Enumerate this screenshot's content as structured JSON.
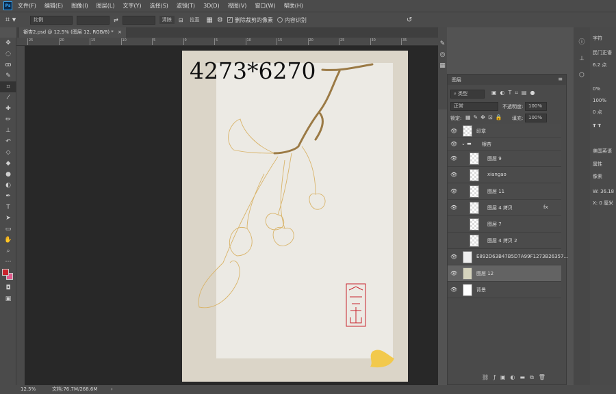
{
  "app": {
    "logo": "Ps"
  },
  "menu": [
    "文件(F)",
    "编辑(E)",
    "图像(I)",
    "图层(L)",
    "文字(Y)",
    "选择(S)",
    "滤镜(T)",
    "3D(D)",
    "视图(V)",
    "窗口(W)",
    "帮助(H)"
  ],
  "options": {
    "ratio": "比例",
    "clear": "清除",
    "straighten": "拉直",
    "delete_cropped": "删除裁剪的像素",
    "delete_cropped_checked": true,
    "content_aware": "内容识别",
    "content_aware_checked": false
  },
  "tab": {
    "title": "银杏2.psd @ 12.5% (图层 12, RGB/8) *",
    "close": "×"
  },
  "ruler": [
    "25",
    "20",
    "15",
    "10",
    "5",
    "0",
    "5",
    "10",
    "15",
    "20",
    "25",
    "30",
    "35"
  ],
  "canvas": {
    "dimension_text": "4273*6270",
    "seal_text": "银杏"
  },
  "layers_panel": {
    "title": "图层",
    "filter": "类型",
    "blend": "正常",
    "opacity_label": "不透明度:",
    "opacity": "100%",
    "lock_label": "锁定:",
    "fill_label": "填充:",
    "fill": "100%",
    "layers": [
      {
        "name": "印章",
        "visible": true,
        "indent": 0
      },
      {
        "name": "银杏",
        "visible": true,
        "group": true,
        "indent": 0
      },
      {
        "name": "图层 9",
        "visible": true,
        "indent": 1
      },
      {
        "name": "xiangao",
        "visible": true,
        "indent": 1
      },
      {
        "name": "图层 11",
        "visible": true,
        "indent": 1
      },
      {
        "name": "图层 4 拷贝",
        "visible": true,
        "indent": 1,
        "fx": "fx"
      },
      {
        "name": "图层 7",
        "visible": false,
        "indent": 1
      },
      {
        "name": "图层 4 拷贝 2",
        "visible": false,
        "indent": 1
      },
      {
        "name": "E892D63B47B5D7A99F1273B26357...",
        "visible": true,
        "indent": 0
      },
      {
        "name": "图层 12",
        "visible": true,
        "indent": 0,
        "selected": true
      },
      {
        "name": "背景",
        "visible": true,
        "indent": 0
      }
    ]
  },
  "character_panel": {
    "tab": "字符",
    "font": "民门正谱",
    "size": "6.2 点",
    "tracking": "0%",
    "scale": "100%",
    "baseline": "0 点",
    "language": "美国英语",
    "properties_tab": "属性",
    "pixel": "像素",
    "w": "W: 36.18",
    "x": "X: 0 厘米"
  },
  "status": {
    "zoom": "12.5%",
    "doc": "文档:76.7M/268.6M",
    "arrow": "›"
  },
  "colors": {
    "foreground": "#c8232c",
    "background": "#e05a8c",
    "seal": "#c8232c",
    "branch": "#9b7a45",
    "leaf_line": "#d9b46a"
  }
}
